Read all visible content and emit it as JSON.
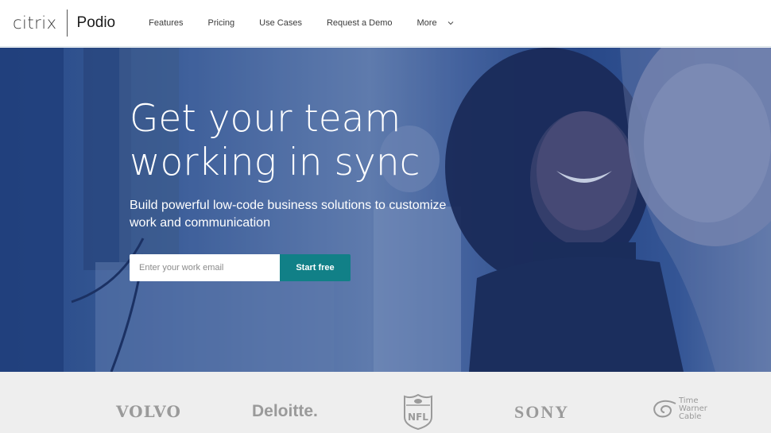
{
  "header": {
    "brand": {
      "parent": "citrix",
      "product": "Podio"
    },
    "nav": [
      {
        "label": "Features"
      },
      {
        "label": "Pricing"
      },
      {
        "label": "Use Cases"
      },
      {
        "label": "Request a Demo"
      },
      {
        "label": "More",
        "icon": "chevron-down-icon"
      }
    ]
  },
  "hero": {
    "title_line1": "Get your team",
    "title_line2": "working in sync",
    "subtitle": "Build powerful low-code business solutions to customize work and communication",
    "email_placeholder": "Enter your work email",
    "cta_label": "Start free",
    "cta_color": "#118087"
  },
  "logos": {
    "volvo": "VOLVO",
    "deloitte": "Deloitte.",
    "nfl": "NFL",
    "sony": "SONY",
    "twc_line1": "Time",
    "twc_line2": "Warner",
    "twc_line3": "Cable"
  }
}
